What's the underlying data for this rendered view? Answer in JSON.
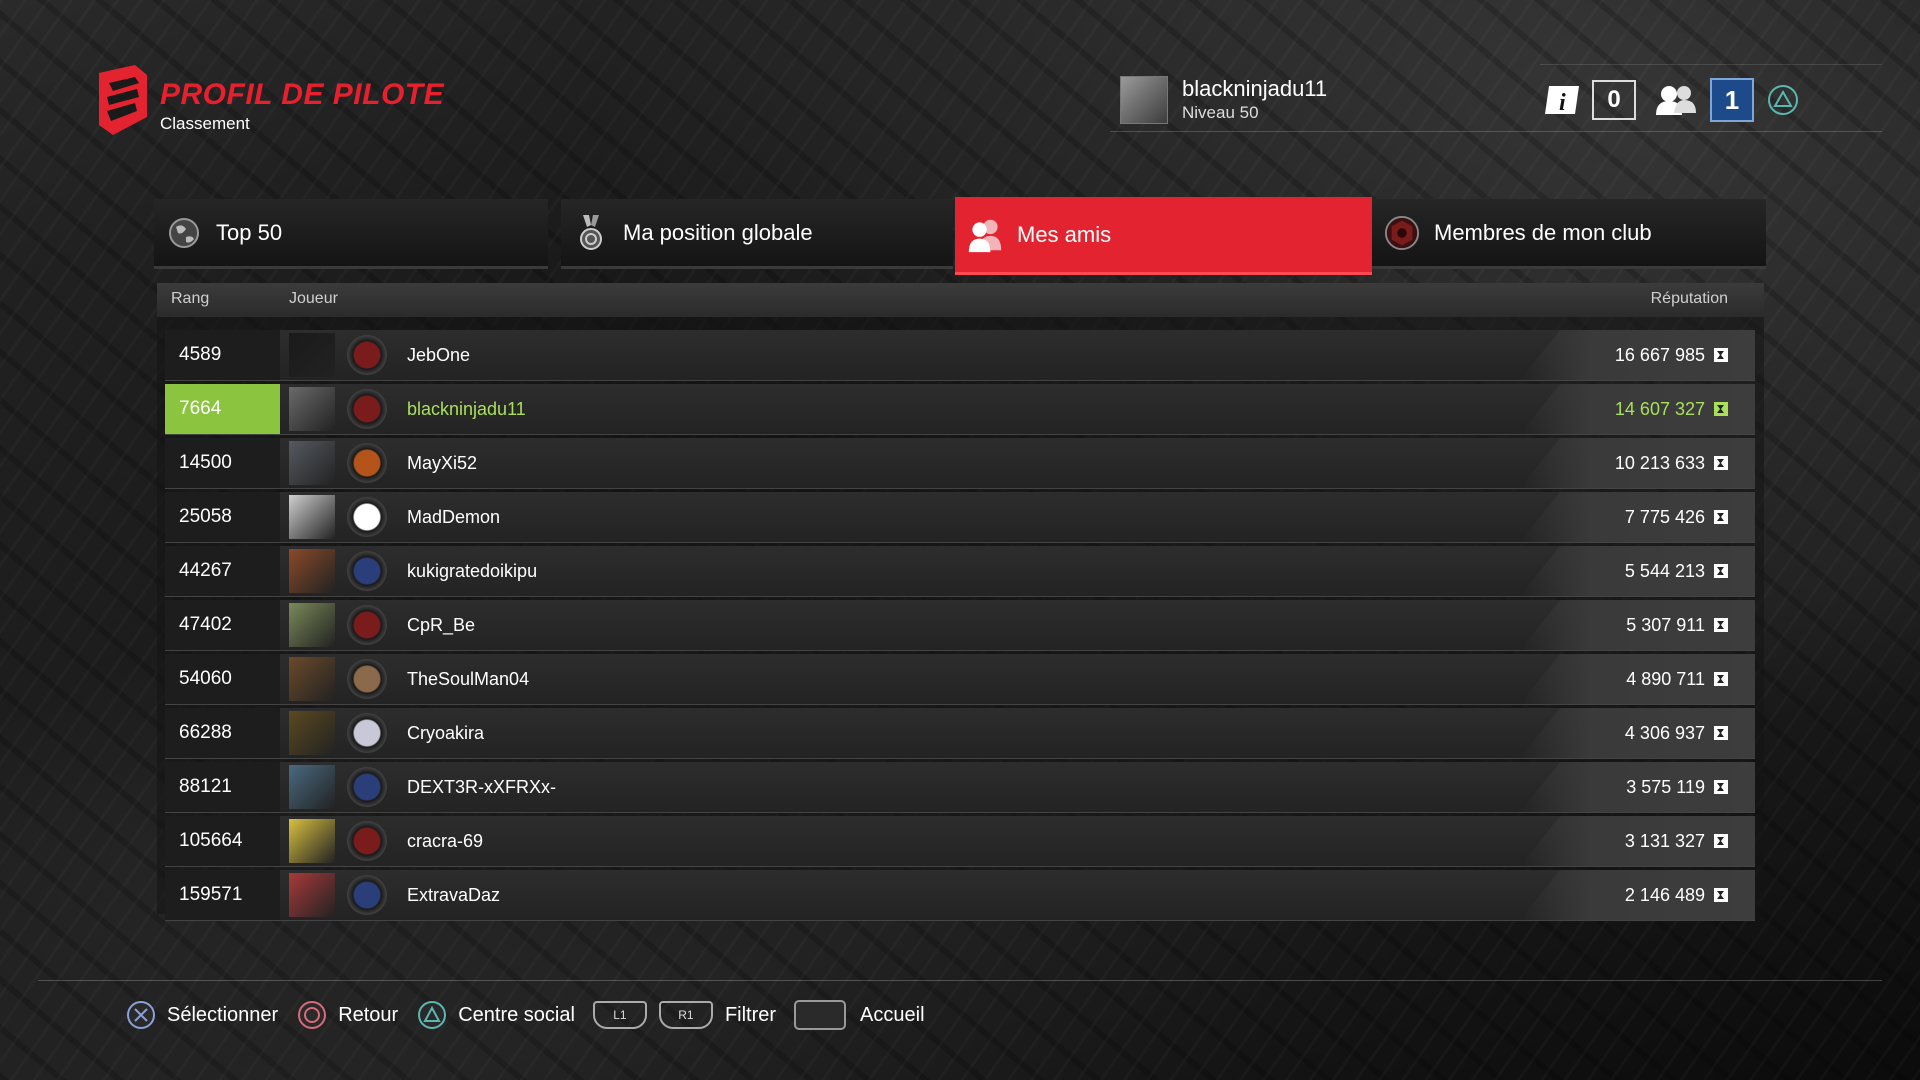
{
  "header": {
    "title": "PROFIL DE PILOTE",
    "subtitle": "Classement",
    "user": {
      "name": "blackninjadu11",
      "level": "Niveau 50"
    },
    "info_icon": "info-icon",
    "count": "0",
    "friends_icon": "friends-icon",
    "notifications": "1",
    "triangle_icon": "triangle-icon"
  },
  "tabs": [
    {
      "label": "Top 50",
      "icon": "globe-icon",
      "active": false
    },
    {
      "label": "Ma position globale",
      "icon": "medal-icon",
      "active": false
    },
    {
      "label": "Mes amis",
      "icon": "friends-icon",
      "active": true
    },
    {
      "label": "Membres de mon club",
      "icon": "club-icon",
      "active": false
    }
  ],
  "table": {
    "headers": {
      "rank": "Rang",
      "player": "Joueur",
      "reputation": "Réputation"
    },
    "rows": [
      {
        "rank": "4589",
        "name": "JebOne",
        "reputation": "16 667 985",
        "avatar_color": "#1a1a1a",
        "badge_color": "#7a1c1c",
        "me": false
      },
      {
        "rank": "7664",
        "name": "blackninjadu11",
        "reputation": "14 607 327",
        "avatar_color": "#6a6a6a",
        "badge_color": "#7a1c1c",
        "me": true
      },
      {
        "rank": "14500",
        "name": "MayXi52",
        "reputation": "10 213 633",
        "avatar_color": "#555a60",
        "badge_color": "#b5541a",
        "me": false
      },
      {
        "rank": "25058",
        "name": "MadDemon",
        "reputation": "7 775 426",
        "avatar_color": "#cfcfcf",
        "badge_color": "#ffffff",
        "me": false
      },
      {
        "rank": "44267",
        "name": "kukigratedoikipu",
        "reputation": "5 544 213",
        "avatar_color": "#8a4a2a",
        "badge_color": "#2a3f7a",
        "me": false
      },
      {
        "rank": "47402",
        "name": "CpR_Be",
        "reputation": "5 307 911",
        "avatar_color": "#7a8a5a",
        "badge_color": "#7a1c1c",
        "me": false
      },
      {
        "rank": "54060",
        "name": "TheSoulMan04",
        "reputation": "4 890 711",
        "avatar_color": "#6a4a2a",
        "badge_color": "#8a6a4a",
        "me": false
      },
      {
        "rank": "66288",
        "name": "Cryoakira",
        "reputation": "4 306 937",
        "avatar_color": "#5a4a20",
        "badge_color": "#c8c8d8",
        "me": false
      },
      {
        "rank": "88121",
        "name": "DEXT3R-xXFRXx-",
        "reputation": "3 575 119",
        "avatar_color": "#4a6a80",
        "badge_color": "#2a3f7a",
        "me": false
      },
      {
        "rank": "105664",
        "name": "cracra-69",
        "reputation": "3 131 327",
        "avatar_color": "#d8c040",
        "badge_color": "#7a1c1c",
        "me": false
      },
      {
        "rank": "159571",
        "name": "ExtravaDaz",
        "reputation": "2 146 489",
        "avatar_color": "#a83a3a",
        "badge_color": "#2a3f7a",
        "me": false
      }
    ]
  },
  "footer": {
    "select": "Sélectionner",
    "back": "Retour",
    "social": "Centre social",
    "l1": "L1",
    "r1": "R1",
    "filter": "Filtrer",
    "home": "Accueil"
  },
  "colors": {
    "accent_red": "#e32430",
    "me_green": "#8bc540",
    "notif_blue": "#1c4a8a"
  }
}
